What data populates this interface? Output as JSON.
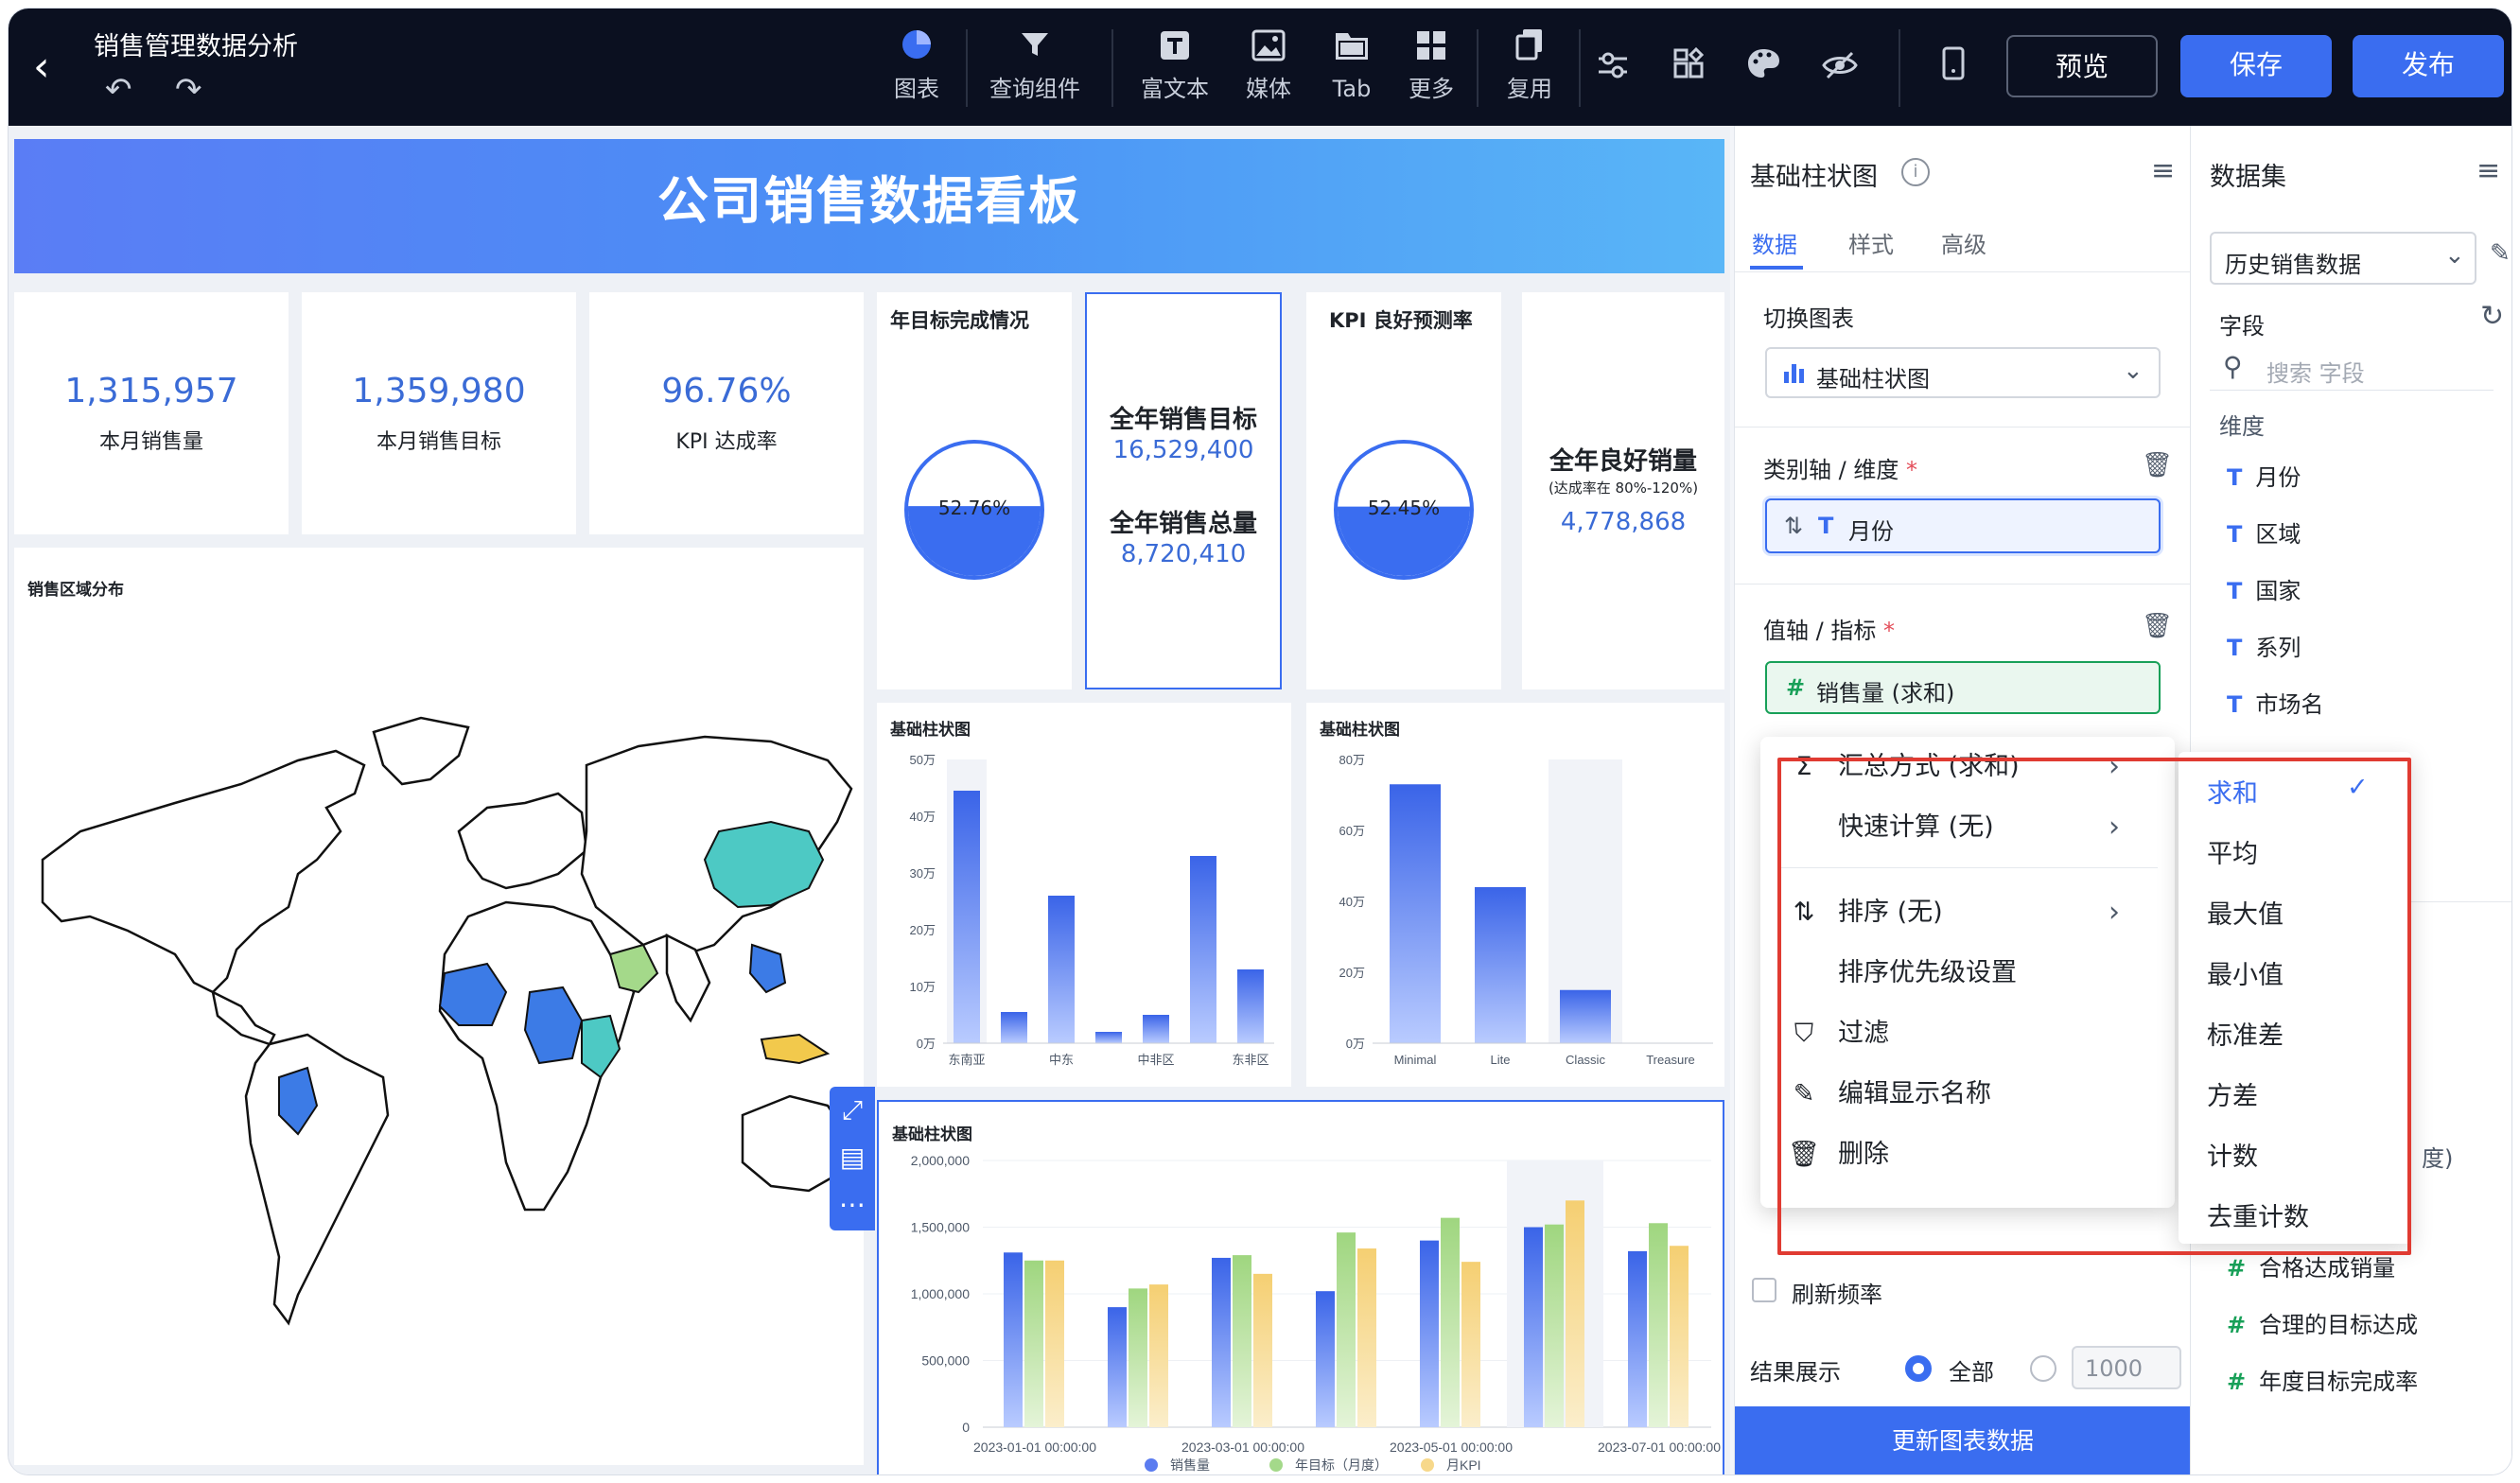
{
  "topbar": {
    "back_icon": "arrow-left-icon",
    "title": "销售管理数据分析",
    "tools": [
      {
        "label": "图表",
        "icon": "pie-chart-icon"
      },
      {
        "label": "查询组件",
        "icon": "filter-icon"
      },
      {
        "label": "富文本",
        "icon": "text-icon"
      },
      {
        "label": "媒体",
        "icon": "image-icon"
      },
      {
        "label": "Tab",
        "icon": "tab-icon"
      },
      {
        "label": "更多",
        "icon": "grid-icon"
      },
      {
        "label": "复用",
        "icon": "copy-icon"
      }
    ],
    "preview": "预览",
    "save": "保存",
    "publish": "发布"
  },
  "dashboard": {
    "banner": "公司销售数据看板",
    "kpis": [
      {
        "value": "1,315,957",
        "label": "本月销售量"
      },
      {
        "value": "1,359,980",
        "label": "本月销售目标"
      },
      {
        "value": "96.76%",
        "label": "KPI 达成率"
      }
    ],
    "goal_card": {
      "title": "年目标完成情况",
      "percent": "52.76%",
      "fill": 0.5276
    },
    "target_card": {
      "l1": "全年销售目标",
      "v1": "16,529,400",
      "l2": "全年销售总量",
      "v2": "8,720,410"
    },
    "kpi_forecast": {
      "title": "KPI 良好预测率",
      "percent": "52.45%",
      "fill": 0.5245
    },
    "good_card": {
      "l1": "全年良好销量",
      "note": "(达成率在 80%-120%)",
      "v1": "4,778,868"
    },
    "map": {
      "title": "销售区域分布"
    }
  },
  "chart_data": [
    {
      "type": "bar",
      "title": "基础柱状图",
      "categories": [
        "东南亚",
        "中东",
        "中非区",
        "东非区"
      ],
      "bar_labels": [
        "东南亚",
        "",
        "中东",
        "",
        "中非区",
        "",
        "东非区"
      ],
      "values": [
        44.5,
        5.5,
        26,
        2,
        5,
        33,
        13
      ],
      "ylim": [
        0,
        50
      ],
      "yticks": [
        "0万",
        "10万",
        "20万",
        "30万",
        "40万",
        "50万"
      ]
    },
    {
      "type": "bar",
      "title": "基础柱状图",
      "categories": [
        "Minimal",
        "Lite",
        "Classic",
        "Treasure"
      ],
      "values": [
        73,
        44,
        15,
        0
      ],
      "ylim": [
        0,
        80
      ],
      "yticks": [
        "0万",
        "20万",
        "40万",
        "60万",
        "80万"
      ]
    },
    {
      "type": "bar",
      "title": "基础柱状图",
      "categories": [
        "2023-01-01 00:00:00",
        "2023-03-01 00:00:00",
        "2023-05-01 00:00:00",
        "2023-07-01 00:00:00"
      ],
      "ylim": [
        0,
        2000000
      ],
      "yticks": [
        "0",
        "500,000",
        "1,000,000",
        "1,500,000",
        "2,000,000"
      ],
      "series": [
        {
          "name": "销售量",
          "color": "#5b7cf0",
          "values": [
            1310000,
            900000,
            1270000,
            1020000,
            1400000,
            1500000,
            1320000
          ]
        },
        {
          "name": "年目标（月度）",
          "color": "#a4d98a",
          "values": [
            1250000,
            1040000,
            1290000,
            1460000,
            1570000,
            1520000,
            1530000
          ]
        },
        {
          "name": "月KPI",
          "color": "#f7d88a",
          "values": [
            1250000,
            1070000,
            1150000,
            1340000,
            1240000,
            1700000,
            1360000
          ]
        }
      ]
    }
  ],
  "config": {
    "title": "基础柱状图",
    "tabs": [
      "数据",
      "样式",
      "高级"
    ],
    "switch_label": "切换图表",
    "chart_type": "基础柱状图",
    "dim_label": "类别轴 / 维度",
    "dim_field": "月份",
    "metric_label": "值轴 / 指标",
    "metric_field": "销售量 (求和)",
    "refresh_label": "刷新频率",
    "result_label": "结果展示",
    "result_all": "全部",
    "result_limit": "1000",
    "update_btn": "更新图表数据"
  },
  "menu": {
    "items": [
      {
        "label": "汇总方式 (求和)",
        "icon": "sum-icon",
        "arrow": true
      },
      {
        "label": "快速计算 (无)",
        "icon": "",
        "arrow": true
      },
      {
        "label": "排序 (无)",
        "icon": "sort-icon",
        "arrow": true
      },
      {
        "label": "排序优先级设置",
        "icon": "",
        "arrow": false
      },
      {
        "label": "过滤",
        "icon": "filter-icon",
        "arrow": false
      },
      {
        "label": "编辑显示名称",
        "icon": "edit-icon",
        "arrow": false
      },
      {
        "label": "删除",
        "icon": "trash-icon",
        "arrow": false
      }
    ],
    "agg": [
      "求和",
      "平均",
      "最大值",
      "最小值",
      "标准差",
      "方差",
      "计数",
      "去重计数"
    ],
    "agg_selected": "求和"
  },
  "dataset": {
    "title": "数据集",
    "source": "历史销售数据",
    "fields_label": "字段",
    "search_placeholder": "搜索 字段",
    "dim_label": "维度",
    "dims": [
      "月份",
      "区域",
      "国家",
      "系列",
      "市场名"
    ],
    "measures": [
      "合格达成销量",
      "合理的目标达成",
      "年度目标完成率"
    ],
    "partial": "度)"
  }
}
